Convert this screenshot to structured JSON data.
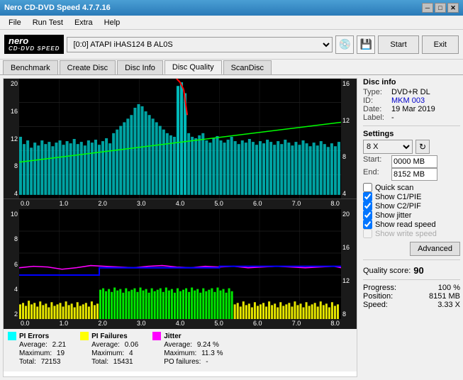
{
  "titleBar": {
    "title": "Nero CD-DVD Speed 4.7.7.16",
    "controls": [
      "minimize",
      "maximize",
      "close"
    ]
  },
  "menuBar": {
    "items": [
      "File",
      "Run Test",
      "Extra",
      "Help"
    ]
  },
  "toolbar": {
    "logo": {
      "line1": "nero",
      "line2": "CD·DVD SPEED"
    },
    "drive": "[0:0]  ATAPI iHAS124  B AL0S",
    "startLabel": "Start",
    "exitLabel": "Exit"
  },
  "tabs": {
    "items": [
      "Benchmark",
      "Create Disc",
      "Disc Info",
      "Disc Quality",
      "ScanDisc"
    ],
    "active": "Disc Quality"
  },
  "discInfo": {
    "title": "Disc info",
    "type_label": "Type:",
    "type_value": "DVD+R DL",
    "id_label": "ID:",
    "id_value": "MKM 003",
    "date_label": "Date:",
    "date_value": "19 Mar 2019",
    "label_label": "Label:",
    "label_value": "-"
  },
  "settings": {
    "title": "Settings",
    "speed": "8 X",
    "start_label": "Start:",
    "start_value": "0000 MB",
    "end_label": "End:",
    "end_value": "8152 MB"
  },
  "checkboxes": {
    "quick_scan": {
      "label": "Quick scan",
      "checked": false
    },
    "show_c1_pie": {
      "label": "Show C1/PIE",
      "checked": true
    },
    "show_c2_pif": {
      "label": "Show C2/PIF",
      "checked": true
    },
    "show_jitter": {
      "label": "Show jitter",
      "checked": true
    },
    "show_read_speed": {
      "label": "Show read speed",
      "checked": true
    },
    "show_write_speed": {
      "label": "Show write speed",
      "checked": false,
      "disabled": true
    }
  },
  "advancedBtn": "Advanced",
  "quality": {
    "label": "Quality score:",
    "value": "90"
  },
  "progress": {
    "label": "Progress:",
    "value": "100 %",
    "position_label": "Position:",
    "position_value": "8151 MB",
    "speed_label": "Speed:",
    "speed_value": "3.33 X"
  },
  "topChart": {
    "yLabels": [
      "20",
      "16",
      "12",
      "8",
      "4"
    ],
    "xLabels": [
      "0.0",
      "1.0",
      "2.0",
      "3.0",
      "4.0",
      "5.0",
      "6.0",
      "7.0",
      "8.0"
    ],
    "yLabelsRight": [
      "16",
      "12",
      "8",
      "4"
    ]
  },
  "bottomChart": {
    "yLabels": [
      "10",
      "8",
      "6",
      "4",
      "2"
    ],
    "xLabels": [
      "0.0",
      "1.0",
      "2.0",
      "3.0",
      "4.0",
      "5.0",
      "6.0",
      "7.0",
      "8.0"
    ],
    "yLabelsRight": [
      "20",
      "16",
      "12",
      "8"
    ]
  },
  "legend": {
    "pi_errors": {
      "label": "PI Errors",
      "color": "#00ffff",
      "average_label": "Average:",
      "average_value": "2.21",
      "maximum_label": "Maximum:",
      "maximum_value": "19",
      "total_label": "Total:",
      "total_value": "72153"
    },
    "pi_failures": {
      "label": "PI Failures",
      "color": "#ffff00",
      "average_label": "Average:",
      "average_value": "0.06",
      "maximum_label": "Maximum:",
      "maximum_value": "4",
      "total_label": "Total:",
      "total_value": "15431"
    },
    "jitter": {
      "label": "Jitter",
      "color": "#ff00ff",
      "average_label": "Average:",
      "average_value": "9.24 %",
      "maximum_label": "Maximum:",
      "maximum_value": "11.3 %",
      "po_failures_label": "PO failures:",
      "po_failures_value": "-"
    }
  },
  "colors": {
    "accent_blue": "#0078d4",
    "title_bg": "#2a7ab8",
    "chart_bg": "#000000"
  }
}
